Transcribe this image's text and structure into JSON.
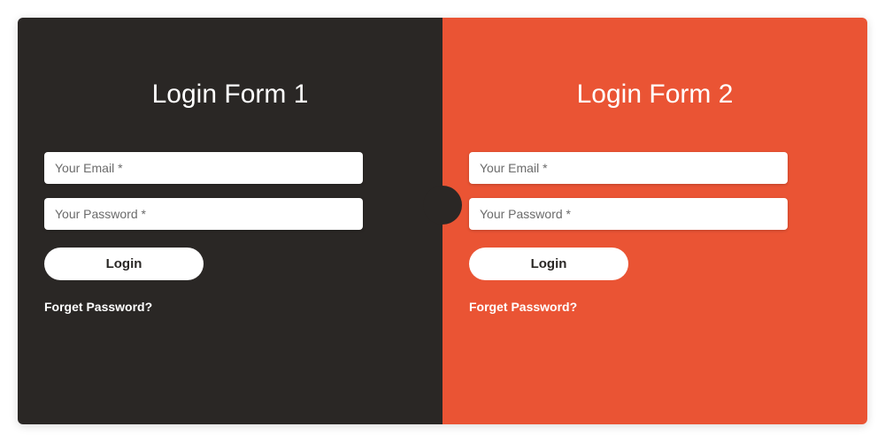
{
  "form1": {
    "title": "Login Form 1",
    "email_placeholder": "Your Email *",
    "password_placeholder": "Your Password *",
    "login_label": "Login",
    "forget_label": "Forget Password?"
  },
  "form2": {
    "title": "Login Form 2",
    "email_placeholder": "Your Email *",
    "password_placeholder": "Your Password *",
    "login_label": "Login",
    "forget_label": "Forget Password?"
  },
  "colors": {
    "dark": "#2a2725",
    "accent": "#ea5434"
  }
}
